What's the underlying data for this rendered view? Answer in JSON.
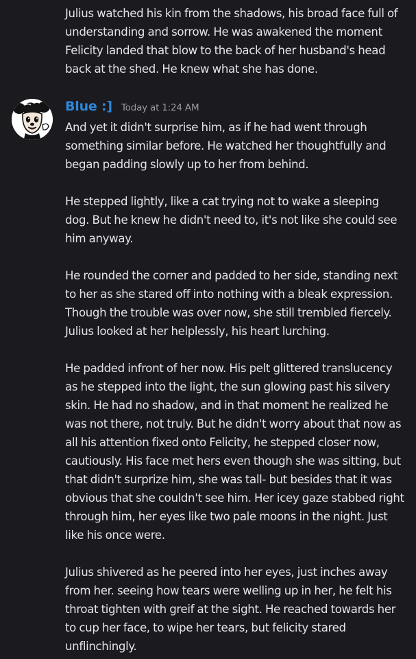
{
  "previous_message": {
    "text": "Julius watched his kin from the shadows, his broad face full of understanding and sorrow. He was awakened the moment Felicity landed that blow to the back of her husband's head back at the shed. He knew what she has done."
  },
  "message": {
    "author": "Blue :]",
    "author_color": "#2f87d8",
    "timestamp": "Today at 1:24 AM",
    "avatar_icon": "cartoon-mouse-avatar-icon",
    "paragraphs": [
      "And yet it didn't surprise him, as if he had went through something similar before. He watched her thoughtfully and began padding slowly up to her from behind.",
      "He stepped lightly, like a cat trying not to wake a sleeping dog. But he knew he didn't need to, it's not like she could see him anyway.",
      "He rounded the corner and padded to her side, standing next to her as she stared off into nothing with a bleak expression. Though the trouble was over now, she still trembled fiercely. Julius looked at her helplessly, his heart lurching.",
      "He padded infront of her now. His pelt glittered translucency as he stepped into the light, the sun glowing past his silvery skin. He had no shadow, and in that moment he realized he was not there, not truly. But he didn't worry about that now as all his attention fixed onto Felicity, he stepped closer now, cautiously. His face met hers even though she was sitting, but that didn't surprize him, she was tall- but besides that it was obvious that she couldn't see him. Her icey gaze stabbed right through him, her eyes like two pale moons in the night. Just like his once were.",
      "Julius shivered as he peered into her eyes, just inches away from her. seeing how tears were welling up in her, he felt his throat tighten with greif at the sight. He reached towards her to cup her face, to wipe her tears, but felicity stared unflinchingly."
    ]
  },
  "colors": {
    "background": "#1a1a1f",
    "text": "#e4e4e8",
    "timestamp": "#9a9aa2"
  }
}
